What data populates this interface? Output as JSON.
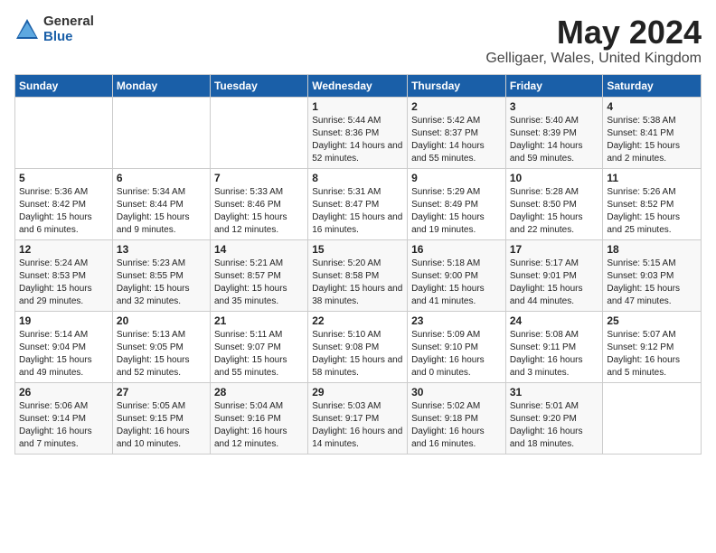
{
  "logo": {
    "general": "General",
    "blue": "Blue"
  },
  "title": "May 2024",
  "subtitle": "Gelligaer, Wales, United Kingdom",
  "days_of_week": [
    "Sunday",
    "Monday",
    "Tuesday",
    "Wednesday",
    "Thursday",
    "Friday",
    "Saturday"
  ],
  "weeks": [
    [
      {
        "day": "",
        "info": ""
      },
      {
        "day": "",
        "info": ""
      },
      {
        "day": "",
        "info": ""
      },
      {
        "day": "1",
        "info": "Sunrise: 5:44 AM\nSunset: 8:36 PM\nDaylight: 14 hours and 52 minutes."
      },
      {
        "day": "2",
        "info": "Sunrise: 5:42 AM\nSunset: 8:37 PM\nDaylight: 14 hours and 55 minutes."
      },
      {
        "day": "3",
        "info": "Sunrise: 5:40 AM\nSunset: 8:39 PM\nDaylight: 14 hours and 59 minutes."
      },
      {
        "day": "4",
        "info": "Sunrise: 5:38 AM\nSunset: 8:41 PM\nDaylight: 15 hours and 2 minutes."
      }
    ],
    [
      {
        "day": "5",
        "info": "Sunrise: 5:36 AM\nSunset: 8:42 PM\nDaylight: 15 hours and 6 minutes."
      },
      {
        "day": "6",
        "info": "Sunrise: 5:34 AM\nSunset: 8:44 PM\nDaylight: 15 hours and 9 minutes."
      },
      {
        "day": "7",
        "info": "Sunrise: 5:33 AM\nSunset: 8:46 PM\nDaylight: 15 hours and 12 minutes."
      },
      {
        "day": "8",
        "info": "Sunrise: 5:31 AM\nSunset: 8:47 PM\nDaylight: 15 hours and 16 minutes."
      },
      {
        "day": "9",
        "info": "Sunrise: 5:29 AM\nSunset: 8:49 PM\nDaylight: 15 hours and 19 minutes."
      },
      {
        "day": "10",
        "info": "Sunrise: 5:28 AM\nSunset: 8:50 PM\nDaylight: 15 hours and 22 minutes."
      },
      {
        "day": "11",
        "info": "Sunrise: 5:26 AM\nSunset: 8:52 PM\nDaylight: 15 hours and 25 minutes."
      }
    ],
    [
      {
        "day": "12",
        "info": "Sunrise: 5:24 AM\nSunset: 8:53 PM\nDaylight: 15 hours and 29 minutes."
      },
      {
        "day": "13",
        "info": "Sunrise: 5:23 AM\nSunset: 8:55 PM\nDaylight: 15 hours and 32 minutes."
      },
      {
        "day": "14",
        "info": "Sunrise: 5:21 AM\nSunset: 8:57 PM\nDaylight: 15 hours and 35 minutes."
      },
      {
        "day": "15",
        "info": "Sunrise: 5:20 AM\nSunset: 8:58 PM\nDaylight: 15 hours and 38 minutes."
      },
      {
        "day": "16",
        "info": "Sunrise: 5:18 AM\nSunset: 9:00 PM\nDaylight: 15 hours and 41 minutes."
      },
      {
        "day": "17",
        "info": "Sunrise: 5:17 AM\nSunset: 9:01 PM\nDaylight: 15 hours and 44 minutes."
      },
      {
        "day": "18",
        "info": "Sunrise: 5:15 AM\nSunset: 9:03 PM\nDaylight: 15 hours and 47 minutes."
      }
    ],
    [
      {
        "day": "19",
        "info": "Sunrise: 5:14 AM\nSunset: 9:04 PM\nDaylight: 15 hours and 49 minutes."
      },
      {
        "day": "20",
        "info": "Sunrise: 5:13 AM\nSunset: 9:05 PM\nDaylight: 15 hours and 52 minutes."
      },
      {
        "day": "21",
        "info": "Sunrise: 5:11 AM\nSunset: 9:07 PM\nDaylight: 15 hours and 55 minutes."
      },
      {
        "day": "22",
        "info": "Sunrise: 5:10 AM\nSunset: 9:08 PM\nDaylight: 15 hours and 58 minutes."
      },
      {
        "day": "23",
        "info": "Sunrise: 5:09 AM\nSunset: 9:10 PM\nDaylight: 16 hours and 0 minutes."
      },
      {
        "day": "24",
        "info": "Sunrise: 5:08 AM\nSunset: 9:11 PM\nDaylight: 16 hours and 3 minutes."
      },
      {
        "day": "25",
        "info": "Sunrise: 5:07 AM\nSunset: 9:12 PM\nDaylight: 16 hours and 5 minutes."
      }
    ],
    [
      {
        "day": "26",
        "info": "Sunrise: 5:06 AM\nSunset: 9:14 PM\nDaylight: 16 hours and 7 minutes."
      },
      {
        "day": "27",
        "info": "Sunrise: 5:05 AM\nSunset: 9:15 PM\nDaylight: 16 hours and 10 minutes."
      },
      {
        "day": "28",
        "info": "Sunrise: 5:04 AM\nSunset: 9:16 PM\nDaylight: 16 hours and 12 minutes."
      },
      {
        "day": "29",
        "info": "Sunrise: 5:03 AM\nSunset: 9:17 PM\nDaylight: 16 hours and 14 minutes."
      },
      {
        "day": "30",
        "info": "Sunrise: 5:02 AM\nSunset: 9:18 PM\nDaylight: 16 hours and 16 minutes."
      },
      {
        "day": "31",
        "info": "Sunrise: 5:01 AM\nSunset: 9:20 PM\nDaylight: 16 hours and 18 minutes."
      },
      {
        "day": "",
        "info": ""
      }
    ]
  ]
}
